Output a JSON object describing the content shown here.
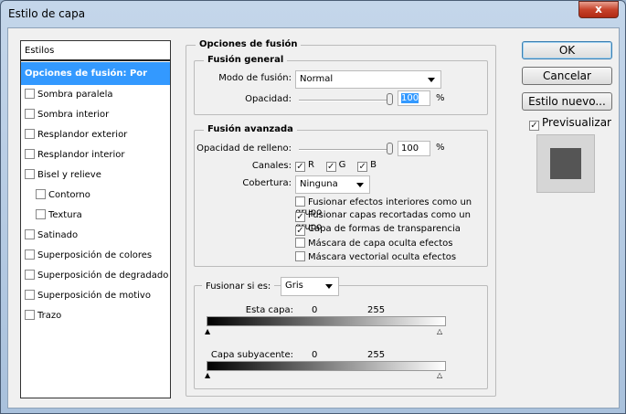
{
  "window": {
    "title": "Estilo de capa",
    "close": "x"
  },
  "sidebar": {
    "header": "Estilos",
    "items": [
      {
        "label": "Opciones de fusión: Por defecto",
        "selected": true
      },
      {
        "label": "Sombra paralela",
        "checked": false
      },
      {
        "label": "Sombra interior",
        "checked": false
      },
      {
        "label": "Resplandor exterior",
        "checked": false
      },
      {
        "label": "Resplandor interior",
        "checked": false
      },
      {
        "label": "Bisel y relieve",
        "checked": false
      },
      {
        "label": "Contorno",
        "checked": false,
        "indent": true
      },
      {
        "label": "Textura",
        "checked": false,
        "indent": true
      },
      {
        "label": "Satinado",
        "checked": false
      },
      {
        "label": "Superposición de colores",
        "checked": false
      },
      {
        "label": "Superposición de degradado",
        "checked": false
      },
      {
        "label": "Superposición de motivo",
        "checked": false
      },
      {
        "label": "Trazo",
        "checked": false
      }
    ]
  },
  "main": {
    "title": "Opciones de fusión",
    "general": {
      "title": "Fusión general",
      "mode_label": "Modo de fusión:",
      "mode": "Normal",
      "opacity_label": "Opacidad:",
      "opacity": "100",
      "pct": "%"
    },
    "advanced": {
      "title": "Fusión avanzada",
      "fill_label": "Opacidad de relleno:",
      "fill": "100",
      "pct": "%",
      "channels_label": "Canales:",
      "channels": [
        "R",
        "G",
        "B"
      ],
      "knockout_label": "Cobertura:",
      "knockout": "Ninguna",
      "options": [
        {
          "label": "Fusionar efectos interiores como un grupo",
          "checked": false
        },
        {
          "label": "Fusionar capas recortadas como un grupo",
          "checked": true
        },
        {
          "label": "Capa de formas de transparencia",
          "checked": true
        },
        {
          "label": "Máscara de capa oculta efectos",
          "checked": false
        },
        {
          "label": "Máscara vectorial oculta efectos",
          "checked": false
        }
      ]
    },
    "blendif": {
      "label": "Fusionar si es:",
      "value": "Gris",
      "this_layer": "Esta capa:",
      "underlying": "Capa subyacente:",
      "min": "0",
      "max": "255"
    }
  },
  "buttons": {
    "ok": "OK",
    "cancel": "Cancelar",
    "new_style": "Estilo nuevo...",
    "preview": "Previsualizar"
  }
}
